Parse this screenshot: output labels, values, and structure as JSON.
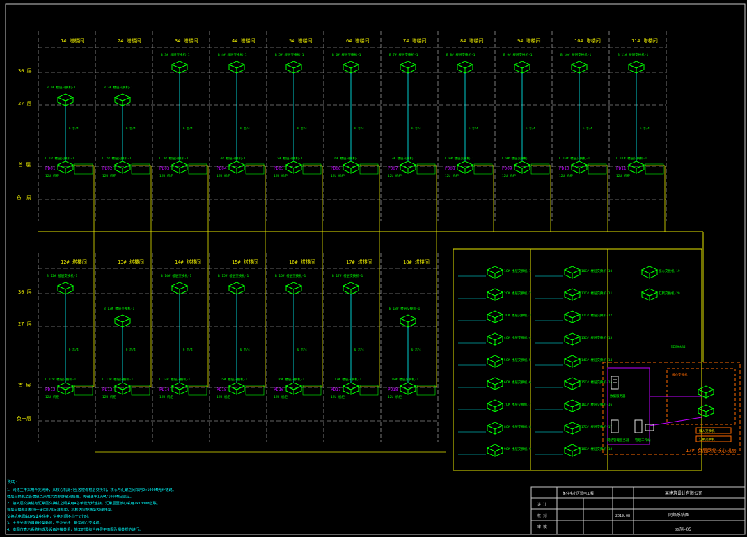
{
  "upper_buildings": [
    {
      "title": "1# 塔楼间",
      "top": "B 1# 楼层交换机-1",
      "mid": "L 1# 楼层交换机-1",
      "pd": "PD01",
      "tag": "12U 机柜"
    },
    {
      "title": "2# 塔楼间",
      "top": "B 2# 楼层交换机-1",
      "mid": "L 2# 楼层交换机-1",
      "pd": "PD02",
      "tag": "12U 机柜"
    },
    {
      "title": "3# 塔楼间",
      "top": "B 3# 楼层交换机-1",
      "mid": "L 3# 楼层交换机-1",
      "pd": "PD03",
      "tag": "12U 机柜"
    },
    {
      "title": "4# 塔楼间",
      "top": "B 4# 楼层交换机-1",
      "mid": "L 4# 楼层交换机-1",
      "pd": "PD04",
      "tag": "12U 机柜"
    },
    {
      "title": "5# 塔楼间",
      "top": "B 5# 楼层交换机-1",
      "mid": "L 5# 楼层交换机-1",
      "pd": "PD05",
      "tag": "12U 机柜"
    },
    {
      "title": "6# 塔楼间",
      "top": "B 6# 楼层交换机-1",
      "mid": "L 6# 楼层交换机-1",
      "pd": "PD06",
      "tag": "12U 机柜"
    },
    {
      "title": "7# 塔楼间",
      "top": "B 7# 楼层交换机-1",
      "mid": "L 7# 楼层交换机-1",
      "pd": "PD07",
      "tag": "12U 机柜"
    },
    {
      "title": "8# 塔楼间",
      "top": "B 8# 楼层交换机-1",
      "mid": "L 8# 楼层交换机-1",
      "pd": "PD08",
      "tag": "12U 机柜"
    },
    {
      "title": "9# 塔楼间",
      "top": "B 9# 楼层交换机-1",
      "mid": "L 9# 楼层交换机-1",
      "pd": "PD09",
      "tag": "12U 机柜"
    },
    {
      "title": "10# 塔楼间",
      "top": "B 10# 楼层交换机-1",
      "mid": "L 10# 楼层交换机-1",
      "pd": "PD10",
      "tag": "12U 机柜"
    },
    {
      "title": "11# 塔楼间",
      "top": "B 11# 楼层交换机-1",
      "mid": "L 11# 楼层交换机-1",
      "pd": "PD11",
      "tag": "12U 机柜"
    }
  ],
  "lower_buildings": [
    {
      "title": "12# 塔楼间",
      "top": "B 12# 楼层交换机-1",
      "mid": "L 12# 楼层交换机-1",
      "pd": "PD12",
      "tag": "12U 机柜"
    },
    {
      "title": "13# 塔楼间",
      "top": "B 13# 楼层交换机-1",
      "mid": "L 13# 楼层交换机-1",
      "pd": "PD13",
      "tag": "12U 机柜"
    },
    {
      "title": "14# 塔楼间",
      "top": "B 14# 楼层交换机-1",
      "mid": "L 14# 楼层交换机-1",
      "pd": "PD14",
      "tag": "12U 机柜"
    },
    {
      "title": "15# 塔楼间",
      "top": "B 15# 楼层交换机-1",
      "mid": "L 15# 楼层交换机-1",
      "pd": "PD15",
      "tag": "12U 机柜"
    },
    {
      "title": "16# 塔楼间",
      "top": "B 16# 楼层交换机-1",
      "mid": "L 16# 楼层交换机-1",
      "pd": "PD16",
      "tag": "12U 机柜"
    },
    {
      "title": "17# 塔楼间",
      "top": "B 17# 楼层交换机-1",
      "mid": "L 17# 楼层交换机-1",
      "pd": "PD17",
      "tag": "12U 机柜"
    },
    {
      "title": "18# 塔楼间",
      "top": "B 18# 楼层交换机-1",
      "mid": "L 18# 楼层交换机-1",
      "pd": "PD18",
      "tag": "12U 机柜"
    }
  ],
  "floor_labels": {
    "f30": "30 层",
    "f27": "27 层",
    "f1": "首 层",
    "fb1": "负一层"
  },
  "fiber_label": "6 芯/4",
  "switch_rows": {
    "col1": [
      "1C# 楼层交换机-1",
      "2C# 楼层交换机-2",
      "3C# 楼层交换机-3",
      "4C# 楼层交换机-4",
      "5C# 楼层交换机-5",
      "6C# 楼层交换机-6",
      "7C# 楼层交换机-7",
      "8C# 楼层交换机-8",
      "9C# 楼层交换机-9"
    ],
    "col2": [
      "10C# 楼层交换机-10",
      "11C# 楼层交换机-11",
      "12C# 楼层交换机-12",
      "13C# 楼层交换机-13",
      "14C# 楼层交换机-14",
      "15C# 楼层交换机-15",
      "16C# 楼层交换机-16",
      "17C# 楼层交换机-17",
      "18C# 楼层交换机-18"
    ],
    "col3": [
      "核心交换机-19",
      "汇聚交换机-20"
    ]
  },
  "core_room": {
    "label": "17# 负层网络核心机房",
    "server1": "数据服务器",
    "server2": "网络管理服务器",
    "workstation": "管理工作站",
    "core_switch": "核心交换机",
    "firewall_note": "出口防火墙",
    "legend1": "接入交换机",
    "legend2": "汇聚交换机"
  },
  "notes": {
    "title": "说明:",
    "lines": [
      "1、网络主干采用千兆光纤，从核心机房引至各楼栋楼层交换机，核心与汇聚之间采用2×1000M光纤链路。",
      "   楼层交换机至各信息点采用六类非屏蔽双绞线，传输速率100M/1000M自适应。",
      "2、接入层交换机与汇聚层交换机之间采用4芯单模光纤连接，汇聚层至核心采用2×1000M上联。",
      "   各层交换机机柜统一采用12U标准机柜，机柜内设配线架及理线架。",
      "   交换机电源由UPS集中供电，供电时间不小于2小时。",
      "3、主干光缆沿弱电桥架敷设，千兆光纤上联至核心交换机。",
      "4、本图仅表示系统构成及设备连接关系，施工时需结合各层平面图及相关规范进行。"
    ]
  },
  "title_block": {
    "company": "某建筑设计有限公司",
    "project": "某住宅小区弱电工程",
    "drawing": "网络系统图",
    "row_labels": [
      "设 计",
      "校 对",
      "审 核"
    ],
    "date": "2019.08",
    "drawing_no": "弱施-05"
  }
}
